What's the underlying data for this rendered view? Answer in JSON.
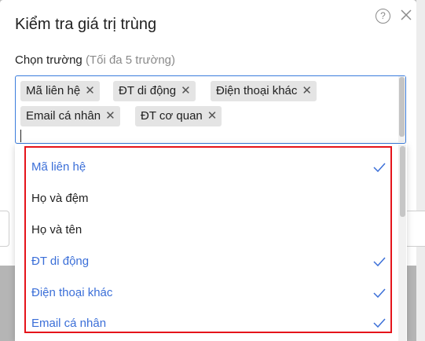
{
  "dialog": {
    "title": "Kiểm tra giá trị trùng",
    "field_label": "Chọn trường",
    "field_hint": "(Tối đa 5 trường)"
  },
  "selected_chips": [
    {
      "label": "Mã liên hệ"
    },
    {
      "label": "ĐT di động"
    },
    {
      "label": "Điện thoại khác"
    },
    {
      "label": "Email cá nhân"
    },
    {
      "label": "ĐT cơ quan"
    }
  ],
  "options": [
    {
      "label": "Mã liên hệ",
      "selected": true
    },
    {
      "label": "Họ và đệm",
      "selected": false
    },
    {
      "label": "Họ và tên",
      "selected": false
    },
    {
      "label": "ĐT di động",
      "selected": true
    },
    {
      "label": "Điện thoại khác",
      "selected": true
    },
    {
      "label": "Email cá nhân",
      "selected": true
    }
  ],
  "icons": {
    "help": "help-circle-icon",
    "close": "close-icon",
    "chip_remove": "x-icon",
    "check": "checkmark-icon"
  },
  "colors": {
    "accent": "#3b6fd8",
    "highlight_border": "#e5141b",
    "chip_bg": "#e4e4e4"
  }
}
